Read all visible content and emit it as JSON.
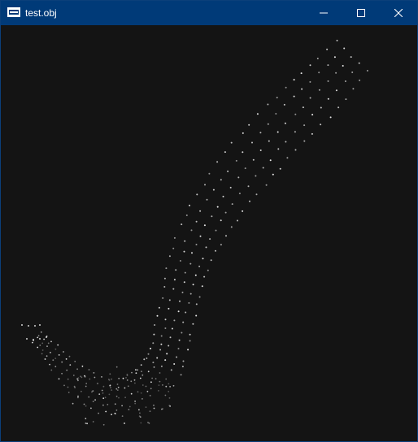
{
  "window": {
    "title": "test.obj",
    "icon": "app-window-icon",
    "controls": [
      "minimize-icon",
      "maximize-icon",
      "close-icon"
    ],
    "colors": {
      "titlebar": "#003a78",
      "background": "#141414",
      "point_bright": "#f2f2f2",
      "point_dim": "#8a8a8a"
    }
  },
  "viewport": {
    "content": "point-cloud"
  }
}
